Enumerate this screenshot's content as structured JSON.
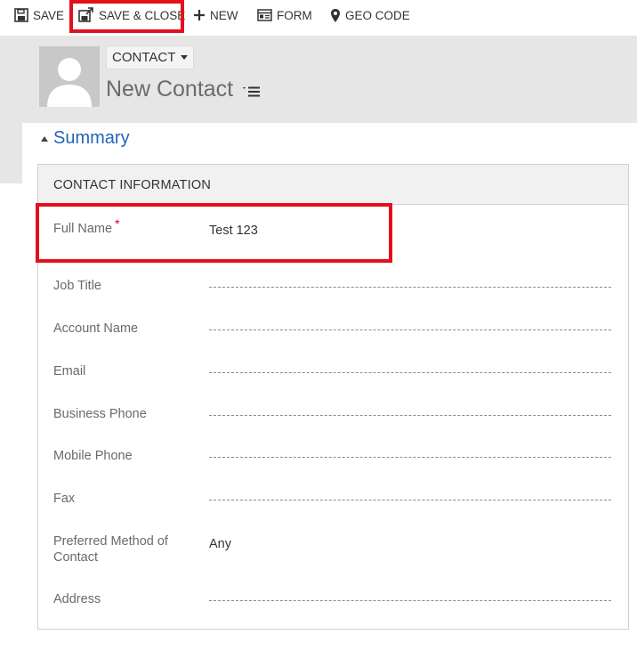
{
  "toolbar": {
    "save_label": "SAVE",
    "save_close_label": "SAVE & CLOSE",
    "new_label": "NEW",
    "form_label": "FORM",
    "geo_code_label": "GEO CODE"
  },
  "header": {
    "entity_type": "CONTACT",
    "record_title": "New Contact"
  },
  "summary": {
    "title": "Summary"
  },
  "section": {
    "title": "CONTACT INFORMATION",
    "fields": [
      {
        "label": "Full Name",
        "value": "Test 123",
        "required_mark": "*"
      },
      {
        "label": "Job Title",
        "value": ""
      },
      {
        "label": "Account Name",
        "value": ""
      },
      {
        "label": "Email",
        "value": ""
      },
      {
        "label": "Business Phone",
        "value": ""
      },
      {
        "label": "Mobile Phone",
        "value": ""
      },
      {
        "label": "Fax",
        "value": ""
      },
      {
        "label": "Preferred Method of Contact",
        "label_line1": "Preferred Method of",
        "label_line2": "Contact",
        "value": "Any"
      },
      {
        "label": "Address",
        "value": ""
      }
    ]
  },
  "icons": [
    "save-icon",
    "save-close-icon",
    "new-icon",
    "form-icon",
    "geo-code-icon",
    "avatar-icon",
    "chevron-down-icon",
    "menu-icon",
    "collapse-icon"
  ],
  "colors": {
    "highlight": "#e3101d",
    "summary_link": "#2266b8",
    "required": "#d0021b",
    "header_band": "#e6e6e6"
  }
}
